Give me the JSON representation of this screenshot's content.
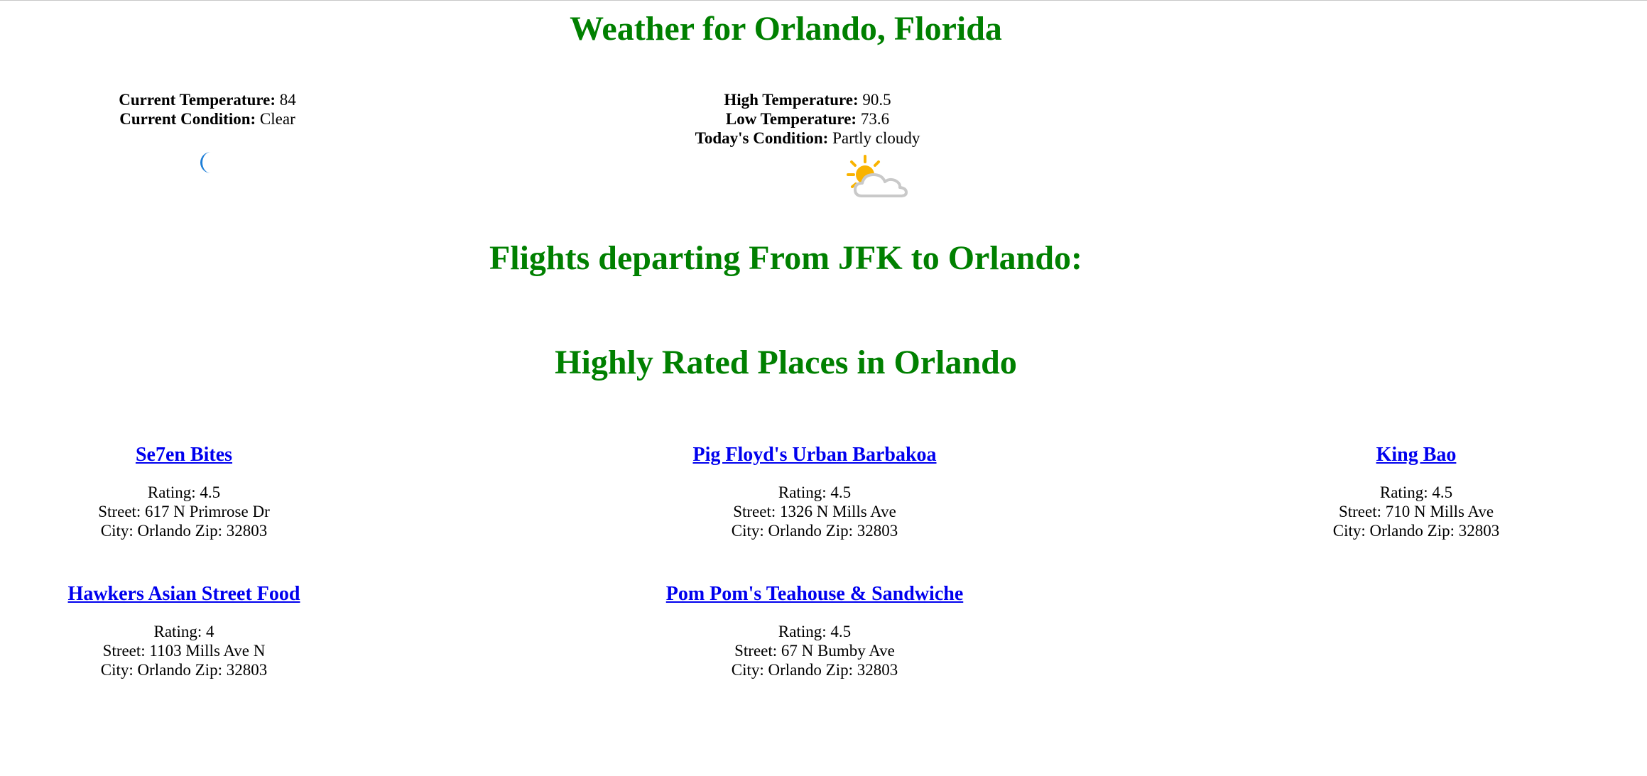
{
  "weather": {
    "heading": "Weather for Orlando, Florida",
    "current": {
      "temp_label": "Current Temperature:",
      "temp_value": "84",
      "condition_label": "Current Condition:",
      "condition_value": "Clear",
      "icon": "crescent-moon-icon"
    },
    "today": {
      "high_label": "High Temperature:",
      "high_value": "90.5",
      "low_label": "Low Temperature:",
      "low_value": "73.6",
      "condition_label": "Today's Condition:",
      "condition_value": "Partly cloudy",
      "icon": "partly-cloudy-icon"
    }
  },
  "flights": {
    "heading": "Flights departing From JFK to Orlando:"
  },
  "places": {
    "heading": "Highly Rated Places in Orlando",
    "items": [
      {
        "name": "Se7en Bites",
        "rating": "Rating: 4.5",
        "street": "Street: 617 N Primrose Dr",
        "city": "City: Orlando Zip: 32803"
      },
      {
        "name": "Pig Floyd's Urban Barbakoa",
        "rating": "Rating: 4.5",
        "street": "Street: 1326 N Mills Ave",
        "city": "City: Orlando Zip: 32803"
      },
      {
        "name": "King Bao",
        "rating": "Rating: 4.5",
        "street": "Street: 710 N Mills Ave",
        "city": "City: Orlando Zip: 32803"
      },
      {
        "name": "Hawkers Asian Street Food",
        "rating": "Rating: 4",
        "street": "Street: 1103 Mills Ave N",
        "city": "City: Orlando Zip: 32803"
      },
      {
        "name": "Pom Pom's Teahouse & Sandwiche",
        "rating": "Rating: 4.5",
        "street": "Street: 67 N Bumby Ave",
        "city": "City: Orlando Zip: 32803"
      }
    ]
  },
  "colors": {
    "heading": "#008000",
    "link": "#0000ee",
    "moon": "#1e7fd8",
    "sun": "#f9b300",
    "cloud": "#c9c9c9"
  }
}
